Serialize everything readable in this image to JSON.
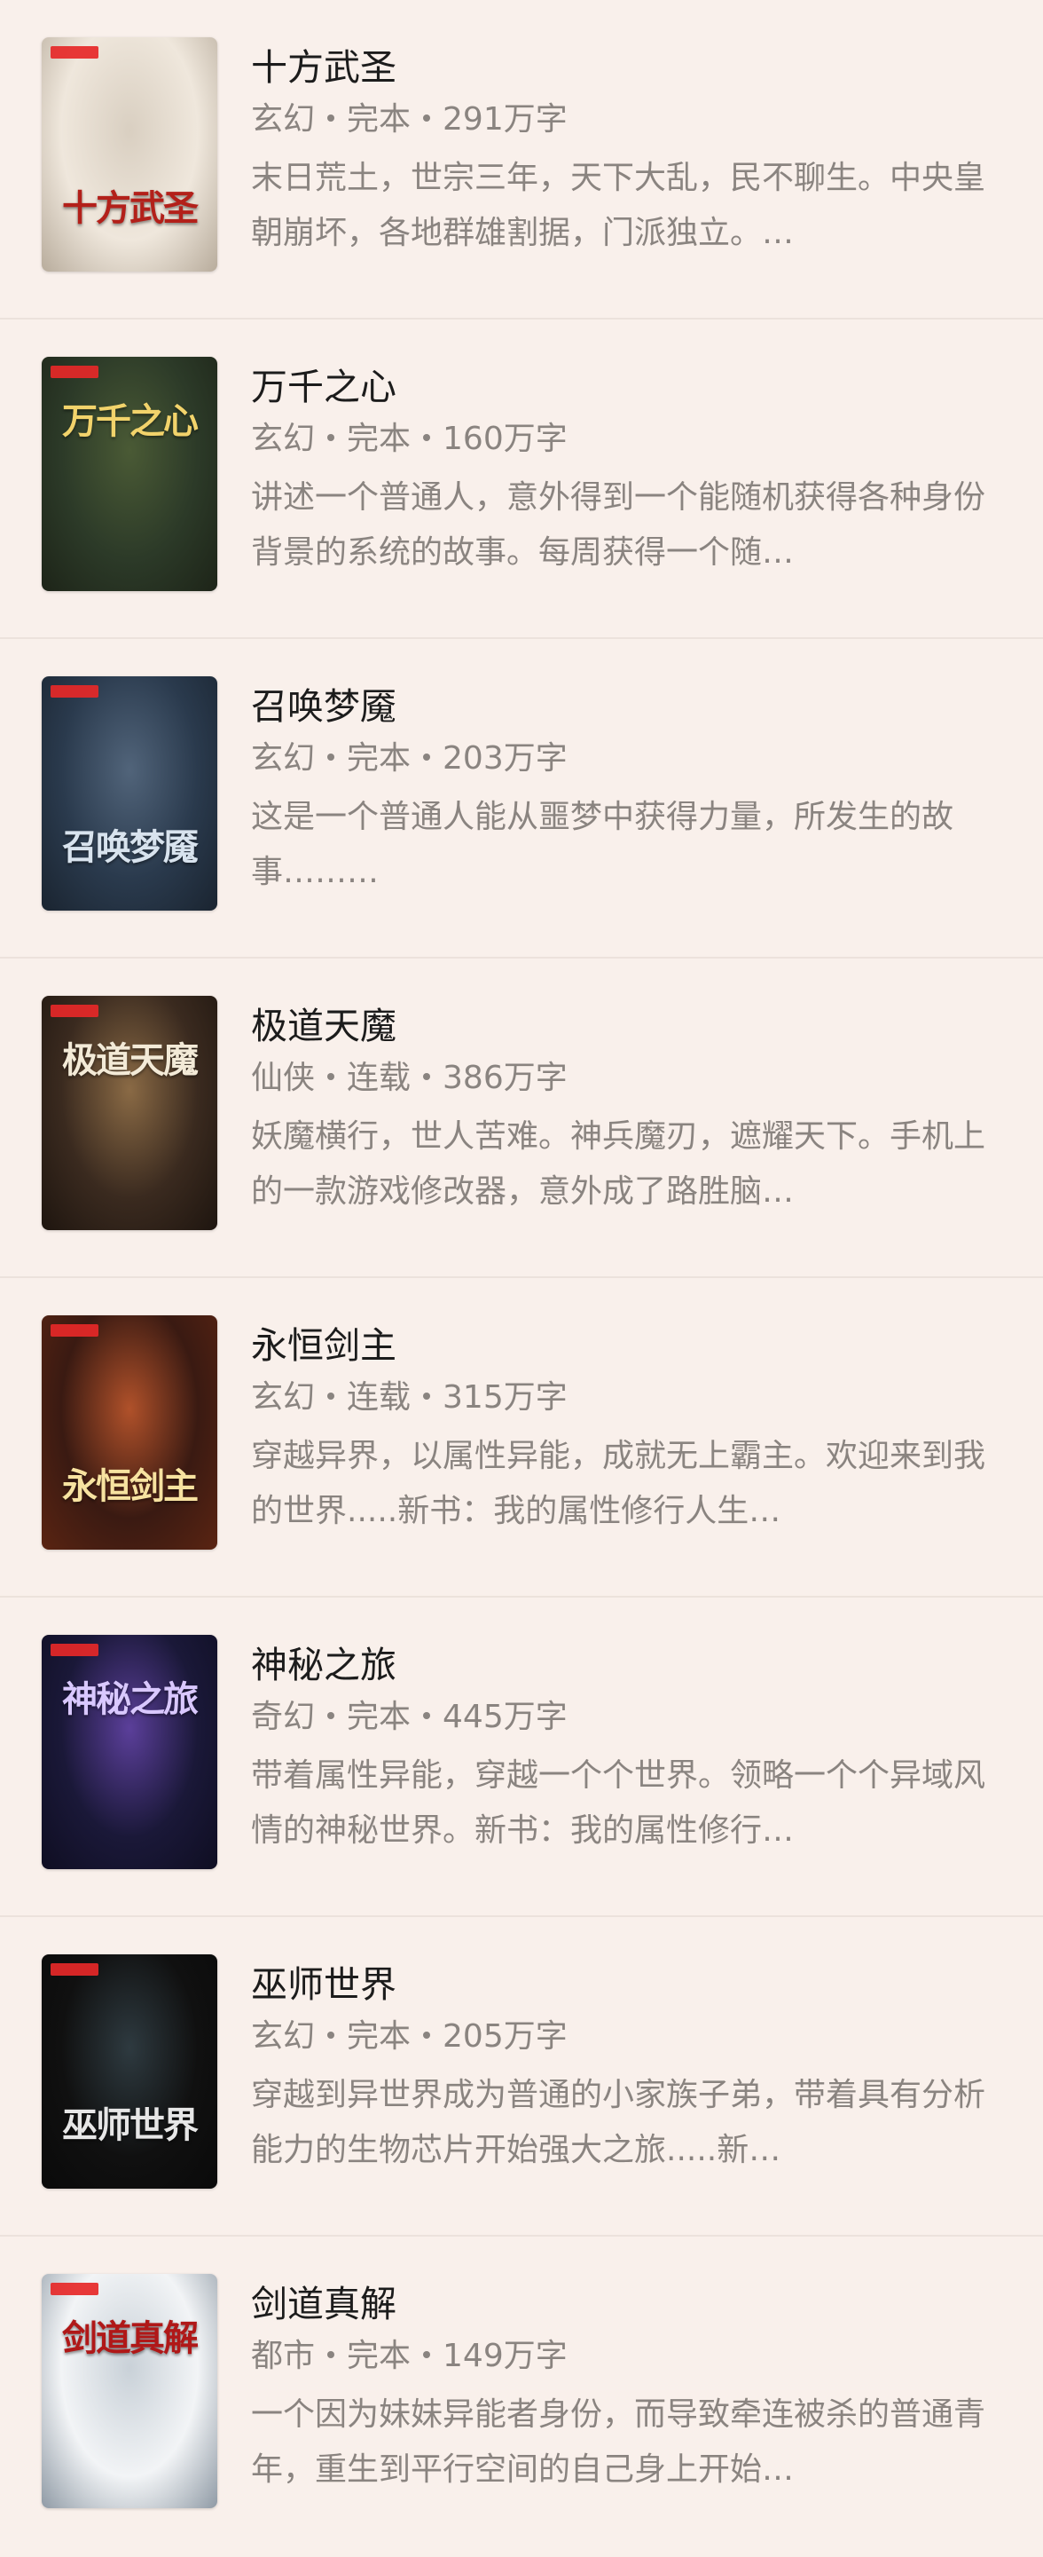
{
  "books": [
    {
      "title": "十方武圣",
      "genre": "玄幻",
      "status": "完本",
      "words": "291万字",
      "description": "末日荒土，世宗三年，天下大乱，民不聊生。中央皇朝崩坏，各地群雄割据，门派独立。…",
      "cover_title": "十方武圣",
      "cover_colors": [
        "#efe7dc",
        "#d9cfc1",
        "#b8ac9c"
      ],
      "cover_title_color": "#b3201a"
    },
    {
      "title": "万千之心",
      "genre": "玄幻",
      "status": "完本",
      "words": "160万字",
      "description": "讲述一个普通人，意外得到一个能随机获得各种身份背景的系统的故事。每周获得一个随…",
      "cover_title": "万千之心",
      "cover_colors": [
        "#2c3a28",
        "#4a5a35",
        "#1d2418"
      ],
      "cover_title_color": "#f2d36b"
    },
    {
      "title": "召唤梦魇",
      "genre": "玄幻",
      "status": "完本",
      "words": "203万字",
      "description": "这是一个普通人能从噩梦中获得力量，所发生的故事………",
      "cover_title": "召唤梦魇",
      "cover_colors": [
        "#2a3a4d",
        "#51647a",
        "#1a2430"
      ],
      "cover_title_color": "#d8e3ee"
    },
    {
      "title": "极道天魔",
      "genre": "仙侠",
      "status": "连载",
      "words": "386万字",
      "description": "妖魔横行，世人苦难。神兵魔刃，遮耀天下。手机上的一款游戏修改器，意外成了路胜脑…",
      "cover_title": "极道天魔",
      "cover_colors": [
        "#3a2a1f",
        "#8a6a45",
        "#1e150f"
      ],
      "cover_title_color": "#f3ead7"
    },
    {
      "title": "永恒剑主",
      "genre": "玄幻",
      "status": "连载",
      "words": "315万字",
      "description": "穿越异界，以属性异能，成就无上霸主。欢迎来到我的世界.....新书：我的属性修行人生…",
      "cover_title": "永恒剑主",
      "cover_colors": [
        "#3a1a12",
        "#b0512a",
        "#5a2412"
      ],
      "cover_title_color": "#f7e2a0"
    },
    {
      "title": "神秘之旅",
      "genre": "奇幻",
      "status": "完本",
      "words": "445万字",
      "description": "带着属性异能，穿越一个个世界。领略一个个异域风情的神秘世界。新书：我的属性修行…",
      "cover_title": "神秘之旅",
      "cover_colors": [
        "#1a1838",
        "#5b3f9a",
        "#0f0e22"
      ],
      "cover_title_color": "#d9c8ff"
    },
    {
      "title": "巫师世界",
      "genre": "玄幻",
      "status": "完本",
      "words": "205万字",
      "description": "穿越到异世界成为普通的小家族子弟，带着具有分析能力的生物芯片开始强大之旅.....新…",
      "cover_title": "巫师世界",
      "cover_colors": [
        "#101010",
        "#2e3a40",
        "#0a0a0a"
      ],
      "cover_title_color": "#e6e6e6"
    },
    {
      "title": "剑道真解",
      "genre": "都市",
      "status": "完本",
      "words": "149万字",
      "description": "一个因为妹妹异能者身份，而导致牵连被杀的普通青年，重生到平行空间的自己身上开始…",
      "cover_title": "剑道真解",
      "cover_colors": [
        "#f2f4f6",
        "#c9d1d8",
        "#8f9aa5"
      ],
      "cover_title_color": "#b01818"
    }
  ]
}
